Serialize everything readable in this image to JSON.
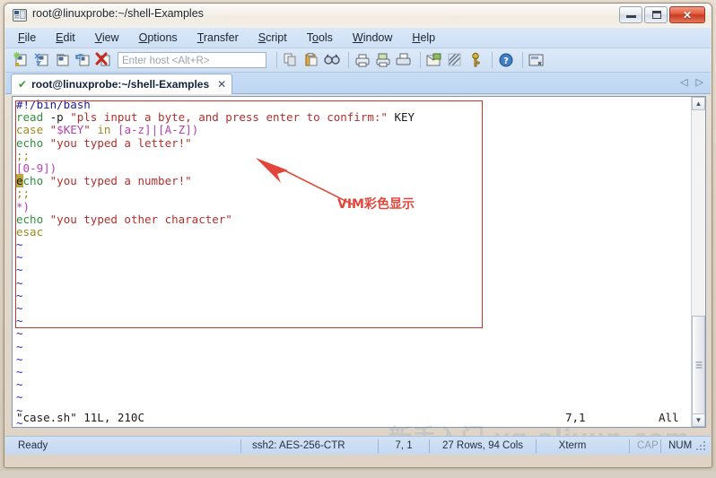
{
  "window": {
    "title": "root@linuxprobe:~/shell-Examples",
    "icon": "terminal-icon",
    "controls": {
      "minimize": "–",
      "maximize": "□",
      "close": "✕"
    }
  },
  "menubar": {
    "items": [
      {
        "label": "File",
        "accel": "F"
      },
      {
        "label": "Edit",
        "accel": "E"
      },
      {
        "label": "View",
        "accel": "V"
      },
      {
        "label": "Options",
        "accel": "O"
      },
      {
        "label": "Transfer",
        "accel": "T"
      },
      {
        "label": "Script",
        "accel": "S"
      },
      {
        "label": "Tools",
        "accel": "T"
      },
      {
        "label": "Window",
        "accel": "W"
      },
      {
        "label": "Help",
        "accel": "H"
      }
    ]
  },
  "toolbar": {
    "host_placeholder": "Enter host <Alt+R>",
    "icons": [
      "new-session-icon",
      "connect-sftp-icon",
      "clone-session-icon",
      "reconnect-icon",
      "disconnect-icon",
      "copy-icon",
      "paste-icon",
      "find-icon",
      "print-icon",
      "print-selection-icon",
      "printer-icon",
      "log-session-icon",
      "settings-icon",
      "key-icon",
      "help-icon",
      "capture-icon"
    ]
  },
  "tab": {
    "label": "root@linuxprobe:~/shell-Examples",
    "status_icon": "green-check-icon",
    "close_icon": "✕",
    "nav_prev": "◁",
    "nav_next": "▷"
  },
  "terminal": {
    "lines": [
      [
        {
          "t": "#!/bin/bash",
          "c": "c-shebang"
        }
      ],
      [
        {
          "t": "read",
          "c": "c-cmd"
        },
        {
          "t": " -p ",
          "c": "c-plain"
        },
        {
          "t": "\"pls input a byte, and press enter to confirm:\"",
          "c": "c-str"
        },
        {
          "t": " KEY",
          "c": "c-plain"
        }
      ],
      [
        {
          "t": "case",
          "c": "c-kw"
        },
        {
          "t": " ",
          "c": "c-plain"
        },
        {
          "t": "\"",
          "c": "c-str"
        },
        {
          "t": "$KEY",
          "c": "c-var"
        },
        {
          "t": "\"",
          "c": "c-str"
        },
        {
          "t": " ",
          "c": "c-plain"
        },
        {
          "t": "in",
          "c": "c-kw"
        },
        {
          "t": " ",
          "c": "c-plain"
        },
        {
          "t": "[a-z]|[A-Z])",
          "c": "c-pat"
        }
      ],
      [
        {
          "t": "echo",
          "c": "c-cmd"
        },
        {
          "t": " ",
          "c": "c-plain"
        },
        {
          "t": "\"you typed a letter!\"",
          "c": "c-str"
        }
      ],
      [
        {
          "t": ";;",
          "c": "c-kw"
        }
      ],
      [
        {
          "t": "[0-9])",
          "c": "c-pat"
        }
      ],
      [
        {
          "t": "e",
          "c": "cursorblk"
        },
        {
          "t": "cho",
          "c": "c-cmd"
        },
        {
          "t": " ",
          "c": "c-plain"
        },
        {
          "t": "\"you typed a number!\"",
          "c": "c-str"
        }
      ],
      [
        {
          "t": ";;",
          "c": "c-kw"
        }
      ],
      [
        {
          "t": "*)",
          "c": "c-pat"
        }
      ],
      [
        {
          "t": "echo",
          "c": "c-cmd"
        },
        {
          "t": " ",
          "c": "c-plain"
        },
        {
          "t": "\"you typed other character\"",
          "c": "c-str"
        }
      ],
      [
        {
          "t": "esac",
          "c": "c-kw"
        }
      ],
      [
        {
          "t": "~",
          "c": "c-tilde"
        }
      ],
      [
        {
          "t": "~",
          "c": "c-tilde"
        }
      ],
      [
        {
          "t": "~",
          "c": "c-tilde"
        }
      ],
      [
        {
          "t": "~",
          "c": "c-tilde"
        }
      ],
      [
        {
          "t": "~",
          "c": "c-tilde"
        }
      ],
      [
        {
          "t": "~",
          "c": "c-tilde"
        }
      ],
      [
        {
          "t": "~",
          "c": "c-tilde"
        }
      ],
      [
        {
          "t": "~",
          "c": "c-tilde"
        }
      ],
      [
        {
          "t": "~",
          "c": "c-tilde"
        }
      ],
      [
        {
          "t": "~",
          "c": "c-tilde"
        }
      ],
      [
        {
          "t": "~",
          "c": "c-tilde"
        }
      ],
      [
        {
          "t": "~",
          "c": "c-tilde"
        }
      ],
      [
        {
          "t": "~",
          "c": "c-tilde"
        }
      ],
      [
        {
          "t": "~",
          "c": "c-tilde"
        }
      ],
      [
        {
          "t": "~",
          "c": "c-tilde"
        }
      ]
    ],
    "vim_status": {
      "file_info": "\"case.sh\" 11L, 210C",
      "position": "7,1",
      "scroll": "All"
    }
  },
  "annotation": {
    "label": "VIM彩色显示",
    "color": "#e2463a"
  },
  "statusbar": {
    "ready": "Ready",
    "cipher": "ssh2: AES-256-CTR",
    "position": "7,  1",
    "dimensions": "27 Rows, 94 Cols",
    "emulation": "Xterm",
    "caps": "CAP",
    "num": "NUM"
  },
  "watermark": {
    "text": "新手入门 yq.aliyun.com"
  }
}
